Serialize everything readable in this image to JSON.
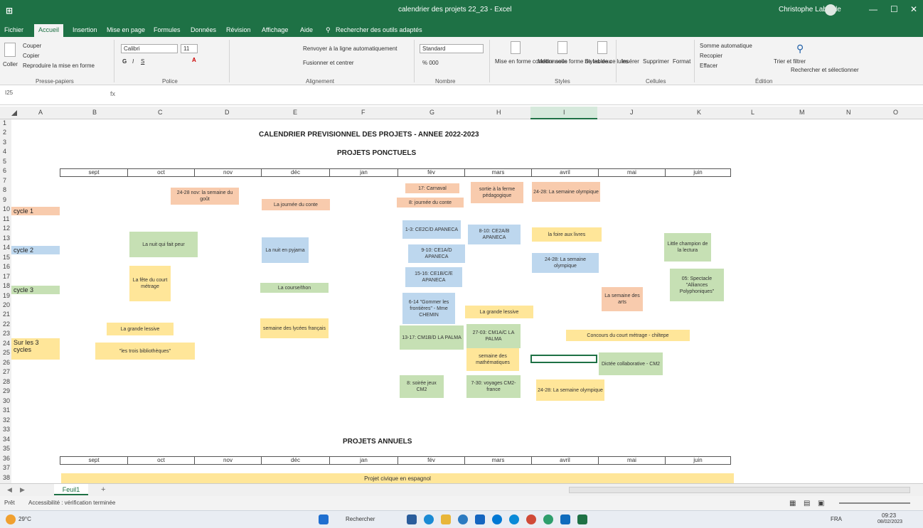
{
  "window": {
    "title": "calendrier des projets 22_23 - Excel",
    "user": "Christophe Labarde",
    "controls": [
      "—",
      "☐",
      "✕"
    ]
  },
  "ribbon_tabs": [
    "Fichier",
    "Accueil",
    "Insertion",
    "Mise en page",
    "Formules",
    "Données",
    "Révision",
    "Affichage",
    "Aide",
    "Rechercher des outils adaptés"
  ],
  "ribbon": {
    "clipboard": {
      "paste": "Coller",
      "cut": "Couper",
      "copy": "Copier",
      "format_painter": "Reproduire la mise en forme",
      "label": "Presse-papiers"
    },
    "font": {
      "name": "Calibri",
      "size": "11",
      "label": "Police"
    },
    "alignment": {
      "wrap": "Renvoyer à la ligne automatiquement",
      "merge": "Fusionner et centrer",
      "label": "Alignement"
    },
    "number": {
      "format": "Standard",
      "label": "Nombre"
    },
    "styles": {
      "conditional": "Mise en forme conditionnelle",
      "as_table": "Mettre sous forme de tableau",
      "cell_styles": "Styles de cellules",
      "label": "Styles"
    },
    "cells": {
      "insert": "Insérer",
      "delete": "Supprimer",
      "format": "Format",
      "label": "Cellules"
    },
    "editing": {
      "autosum": "Somme automatique",
      "fill": "Recopier",
      "clear": "Effacer",
      "sort": "Trier et filtrer",
      "find": "Rechercher et sélectionner",
      "label": "Édition"
    }
  },
  "formula_bar": {
    "name_box": "I25",
    "fx": "fx"
  },
  "columns": [
    "A",
    "B",
    "C",
    "D",
    "E",
    "F",
    "G",
    "H",
    "I",
    "J",
    "K",
    "L",
    "M",
    "N",
    "O"
  ],
  "rows": [
    "1",
    "2",
    "3",
    "4",
    "5",
    "6",
    "7",
    "8",
    "9",
    "10",
    "11",
    "12",
    "13",
    "14",
    "15",
    "16",
    "17",
    "18",
    "19",
    "20",
    "21",
    "22",
    "23",
    "24",
    "25",
    "26",
    "27",
    "28",
    "29",
    "30",
    "31",
    "32",
    "33",
    "34",
    "35",
    "36",
    "37",
    "38"
  ],
  "sheet": {
    "main_title": "CALENDRIER PREVISIONNEL DES PROJETS  - ANNEE 2022-2023",
    "section1": "PROJETS PONCTUELS",
    "section2": "PROJETS ANNUELS",
    "months": [
      "sept",
      "oct",
      "nov",
      "déc",
      "jan",
      "fév",
      "mars",
      "avril",
      "mai",
      "juin"
    ],
    "cycles": {
      "c1": "cycle 1",
      "c2": "cycle 2",
      "c3": "cycle 3",
      "all1": "Sur les 3",
      "all2": "cycles"
    },
    "notes": {
      "gout": "24-28 nov: la semaine du goût",
      "conte_dec": "La journée du conte",
      "carnaval": "17: Carnaval",
      "conte_fev": "8: journée du conte",
      "ferme": "sortie à la ferme pédagogique",
      "olymp1": "24-28: La semaine olympique",
      "nuit_peur": "La nuit qui fait peur",
      "nuit_pyjama": "La nuit en pyjama",
      "apaneca1": "1-3: CE2C/D APANECA",
      "apaneca2": "9-10: CE1A/D APANECA",
      "apaneca3": "15-16: CE1B/C/E APANECA",
      "apaneca4": "8-10: CE2A/B APANECA",
      "foire": "la foire aux livres",
      "olymp2": "24-28: La semaine olympique",
      "champion": "Little champion de la lectura",
      "court": "La fête du court métrage",
      "course": "La course/thon",
      "gommer": "6-14 \"Gommer les frontières\" - Mme CHEMIN",
      "lessive_fev": "La grande lessive",
      "arts": "La semaine des arts",
      "spectacle": "05: Spectacle \"Alliances Polyphoniques\"",
      "lessive_oct": "La grande lessive",
      "lycees": "semaine des lycées français",
      "palma1": "13-17: CM1B/D LA PALMA",
      "palma2": "27-03: CM1A/C LA PALMA",
      "concours": "Concours du court métrage - chiltepe",
      "biblio": "\"les trois bibliothèques\"",
      "maths": "semaine des mathématiques",
      "dictee": "Dictée collaborative - CM2",
      "soiree": "8: soirée jeux CM2",
      "voyage": "7-30: voyages CM2-france",
      "olymp3": "24-28: La semaine olympique",
      "civique": "Projet civique en espagnol"
    }
  },
  "sheet_tabs": {
    "active": "Feuil1",
    "add": "+"
  },
  "status": {
    "ready": "Prêt",
    "accessibility": "Accessibilité : vérification terminée"
  },
  "taskbar": {
    "weather": "29°C",
    "search": "Rechercher",
    "lang": "FRA",
    "time": "09:23",
    "date": "08/02/2023"
  },
  "colors": {
    "excel_green": "#1e7145",
    "pink": "#f8cbad",
    "blue": "#bdd7ee",
    "green": "#c6e0b4",
    "yellow": "#ffe699"
  }
}
